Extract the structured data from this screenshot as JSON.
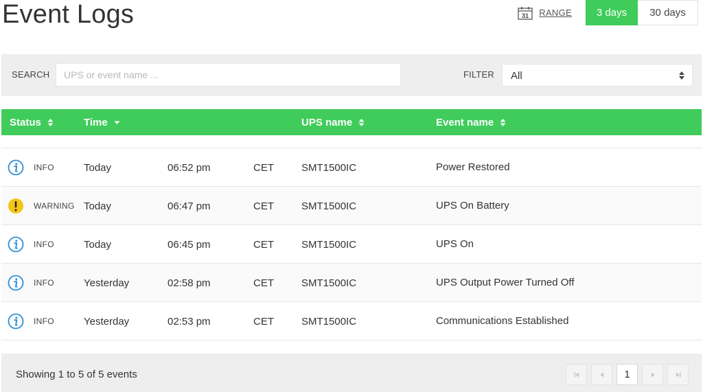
{
  "page": {
    "title": "Event Logs"
  },
  "range": {
    "calendar_day": "31",
    "range_label": "RANGE",
    "options": [
      {
        "label": "3 days",
        "active": true
      },
      {
        "label": "30 days",
        "active": false
      }
    ]
  },
  "search": {
    "label": "SEARCH",
    "placeholder": "UPS or event name ...",
    "value": "",
    "filter_label": "FILTER",
    "filter_value": "All"
  },
  "table": {
    "columns": {
      "status": "Status",
      "time": "Time",
      "ups": "UPS name",
      "event": "Event name"
    },
    "rows": [
      {
        "level": "INFO",
        "icon": "info-icon",
        "day": "Today",
        "clock": "06:52 pm",
        "tz": "CET",
        "ups": "SMT1500IC",
        "event": "Power Restored"
      },
      {
        "level": "WARNING",
        "icon": "warning-icon",
        "day": "Today",
        "clock": "06:47 pm",
        "tz": "CET",
        "ups": "SMT1500IC",
        "event": "UPS On Battery"
      },
      {
        "level": "INFO",
        "icon": "info-icon",
        "day": "Today",
        "clock": "06:45 pm",
        "tz": "CET",
        "ups": "SMT1500IC",
        "event": "UPS On"
      },
      {
        "level": "INFO",
        "icon": "info-icon",
        "day": "Yesterday",
        "clock": "02:58 pm",
        "tz": "CET",
        "ups": "SMT1500IC",
        "event": "UPS Output Power Turned Off"
      },
      {
        "level": "INFO",
        "icon": "info-icon",
        "day": "Yesterday",
        "clock": "02:53 pm",
        "tz": "CET",
        "ups": "SMT1500IC",
        "event": "Communications Established"
      }
    ]
  },
  "footer": {
    "showing": "Showing 1 to 5 of 5 events",
    "current_page": "1"
  },
  "colors": {
    "accent": "#3fcc5a",
    "info": "#2d8fd5",
    "warning": "#f5c518"
  }
}
